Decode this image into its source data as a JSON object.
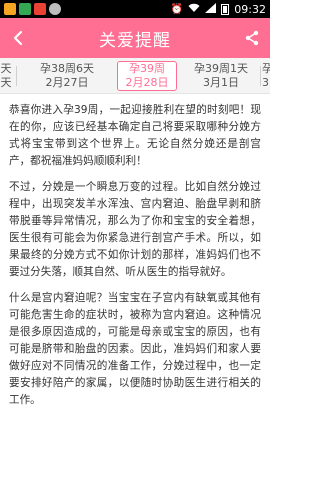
{
  "status_bar": {
    "time": "09:32"
  },
  "header": {
    "title": "关爱提醒"
  },
  "weeks": [
    {
      "week": "天",
      "date": "天"
    },
    {
      "week": "孕38周6天",
      "date": "2月27日"
    },
    {
      "week": "孕39周",
      "date": "2月28日"
    },
    {
      "week": "孕39周1天",
      "date": "3月1日"
    },
    {
      "week": "孕3",
      "date": "3"
    }
  ],
  "colors": {
    "accent": "#ff6f93",
    "status_icon_1": "#f6a623",
    "status_icon_2": "#34a853",
    "status_icon_3": "#e94235",
    "status_icon_4": "#bdbdbd"
  },
  "icons": {
    "back": "chevron-left-icon",
    "share": "share-icon"
  },
  "article": {
    "paragraphs": [
      "恭喜你进入孕39周，一起迎接胜利在望的时刻吧！现在的你，应该已经基本确定自己将要采取哪种分娩方式将宝宝带到这个世界上。无论自然分娩还是剖宫产，都祝福准妈妈顺顺利利！",
      "不过，分娩是一个瞬息万变的过程。比如自然分娩过程中，出现突发羊水浑浊、宫内窘迫、胎盘早剥和脐带脱垂等异常情况，那么为了你和宝宝的安全着想，医生很有可能会为你紧急进行剖宫产手术。所以，如果最终的分娩方式不如你计划的那样，准妈妈们也不要过分失落，顺其自然、听从医生的指导就好。",
      "什么是宫内窘迫呢？当宝宝在子宫内有缺氧或其他有可能危害生命的症状时，被称为宫内窘迫。这种情况是很多原因造成的，可能是母亲或宝宝的原因，也有可能是脐带和胎盘的因素。因此，准妈妈们和家人要做好应对不同情况的准备工作，分娩过程中，也一定要安排好陪产的家属，以便随时协助医生进行相关的工作。"
    ]
  }
}
